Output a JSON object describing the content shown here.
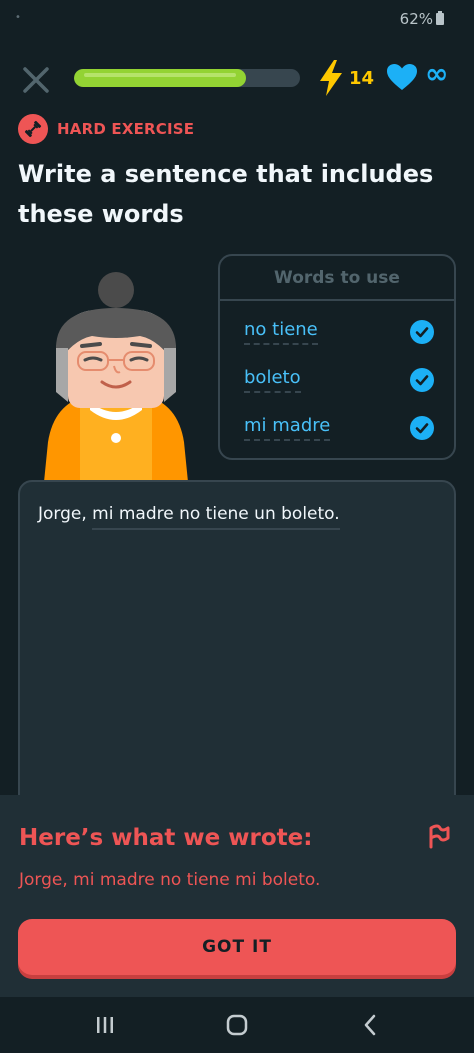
{
  "status_bar": {
    "battery": "62%"
  },
  "header": {
    "progress": 0.76,
    "streak_count": "14",
    "hearts": "∞"
  },
  "exercise": {
    "badge": "HARD EXERCISE",
    "prompt": "Write a sentence that includes these words"
  },
  "words_box": {
    "title": "Words to use",
    "words": [
      {
        "text": "no tiene",
        "checked": true
      },
      {
        "text": "boleto",
        "checked": true
      },
      {
        "text": "mi madre",
        "checked": true
      }
    ]
  },
  "answer": {
    "words": [
      "Jorge,",
      "mi madre no tiene un boleto."
    ]
  },
  "feedback": {
    "title": "Here’s what we wrote:",
    "text": "Jorge, mi madre no tiene mi boleto.",
    "button": "GOT IT"
  },
  "colors": {
    "background": "#131f24",
    "accent_red": "#ee5555",
    "progress_green": "#93d333",
    "link_blue": "#1cb0f6",
    "streak_yellow": "#ffc800"
  },
  "icons": {
    "close": "close-icon",
    "streak": "lightning-icon",
    "heart": "heart-icon",
    "hard": "dumbbell-icon",
    "check": "check-icon",
    "flag": "flag-icon",
    "nav_recent": "recent-apps-icon",
    "nav_home": "home-icon",
    "nav_back": "back-icon"
  }
}
